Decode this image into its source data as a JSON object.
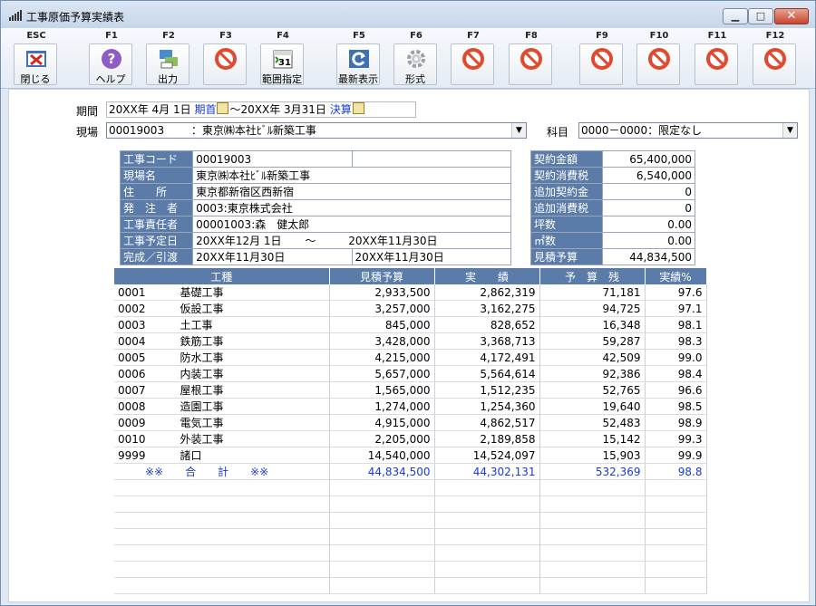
{
  "window": {
    "title": "工事原価予算実績表"
  },
  "toolbar": [
    {
      "key": "ESC",
      "label": "閉じる",
      "icon": "close-doc-icon"
    },
    {
      "key": "F1",
      "label": "ヘルプ",
      "icon": "help-icon"
    },
    {
      "key": "F2",
      "label": "出力",
      "icon": "printer-icon"
    },
    {
      "key": "F3",
      "label": "",
      "icon": "disabled-icon"
    },
    {
      "key": "F4",
      "label": "範囲指定",
      "icon": "calendar-icon"
    },
    {
      "key": "F5",
      "label": "最新表示",
      "icon": "refresh-icon"
    },
    {
      "key": "F6",
      "label": "形式",
      "icon": "gear-icon"
    },
    {
      "key": "F7",
      "label": "",
      "icon": "disabled-icon"
    },
    {
      "key": "F8",
      "label": "",
      "icon": "disabled-icon"
    },
    {
      "key": "F9",
      "label": "",
      "icon": "disabled-icon"
    },
    {
      "key": "F10",
      "label": "",
      "icon": "disabled-icon"
    },
    {
      "key": "F11",
      "label": "",
      "icon": "disabled-icon"
    },
    {
      "key": "F12",
      "label": "",
      "icon": "disabled-icon"
    }
  ],
  "filters": {
    "period_label": "期間",
    "period_start": "20XX年 4月 1日",
    "period_start_tag": "期首",
    "period_sep": "～",
    "period_end": "20XX年 3月31日",
    "period_end_tag": "決算",
    "site_label": "現場",
    "site_code": "00019003",
    "site_name": "：東京㈱本社ﾋﾞﾙ新築工事",
    "account_label": "科目",
    "account_value": "0000－0000：限定なし"
  },
  "info": {
    "code_label": "工事コード",
    "code": "00019003",
    "site_name_label": "現場名",
    "site_name": "東京㈱本社ﾋﾞﾙ新築工事",
    "address_label": "住　　所",
    "address": "東京都新宿区西新宿",
    "client_label": "発　注　者",
    "client": "0003:東京株式会社",
    "manager_label": "工事責任者",
    "manager": "00001003:森　健太郎",
    "schedule_label": "工事予定日",
    "schedule_start": "20XX年12月 1日",
    "schedule_sep": "～",
    "schedule_end": "20XX年11月30日",
    "complete_label": "完成／引渡",
    "complete_date": "20XX年11月30日",
    "delivery_date": "20XX年11月30日"
  },
  "summary": [
    {
      "label": "契約金額",
      "value": "65,400,000"
    },
    {
      "label": "契約消費税",
      "value": "6,540,000"
    },
    {
      "label": "追加契約金",
      "value": "0"
    },
    {
      "label": "追加消費税",
      "value": "0"
    },
    {
      "label": "坪数",
      "value": "0.00"
    },
    {
      "label": "㎡数",
      "value": "0.00"
    },
    {
      "label": "見積予算",
      "value": "44,834,500"
    }
  ],
  "grid": {
    "headers": [
      "工種",
      "見積予算",
      "実　　績",
      "予　算　残",
      "実績%"
    ],
    "rows": [
      {
        "code": "0001",
        "name": "基礎工事",
        "budget": "2,933,500",
        "actual": "2,862,319",
        "remain": "71,181",
        "pct": "97.6"
      },
      {
        "code": "0002",
        "name": "仮設工事",
        "budget": "3,257,000",
        "actual": "3,162,275",
        "remain": "94,725",
        "pct": "97.1"
      },
      {
        "code": "0003",
        "name": "土工事",
        "budget": "845,000",
        "actual": "828,652",
        "remain": "16,348",
        "pct": "98.1"
      },
      {
        "code": "0004",
        "name": "鉄筋工事",
        "budget": "3,428,000",
        "actual": "3,368,713",
        "remain": "59,287",
        "pct": "98.3"
      },
      {
        "code": "0005",
        "name": "防水工事",
        "budget": "4,215,000",
        "actual": "4,172,491",
        "remain": "42,509",
        "pct": "99.0"
      },
      {
        "code": "0006",
        "name": "内装工事",
        "budget": "5,657,000",
        "actual": "5,564,614",
        "remain": "92,386",
        "pct": "98.4"
      },
      {
        "code": "0007",
        "name": "屋根工事",
        "budget": "1,565,000",
        "actual": "1,512,235",
        "remain": "52,765",
        "pct": "96.6"
      },
      {
        "code": "0008",
        "name": "造園工事",
        "budget": "1,274,000",
        "actual": "1,254,360",
        "remain": "19,640",
        "pct": "98.5"
      },
      {
        "code": "0009",
        "name": "電気工事",
        "budget": "4,915,000",
        "actual": "4,862,517",
        "remain": "52,483",
        "pct": "98.9"
      },
      {
        "code": "0010",
        "name": "外装工事",
        "budget": "2,205,000",
        "actual": "2,189,858",
        "remain": "15,142",
        "pct": "99.3"
      },
      {
        "code": "9999",
        "name": "諸口",
        "budget": "14,540,000",
        "actual": "14,524,097",
        "remain": "15,903",
        "pct": "99.9"
      }
    ],
    "total": {
      "label": "※※　　合　　計　　※※",
      "budget": "44,834,500",
      "actual": "44,302,131",
      "remain": "532,369",
      "pct": "98.8"
    }
  }
}
